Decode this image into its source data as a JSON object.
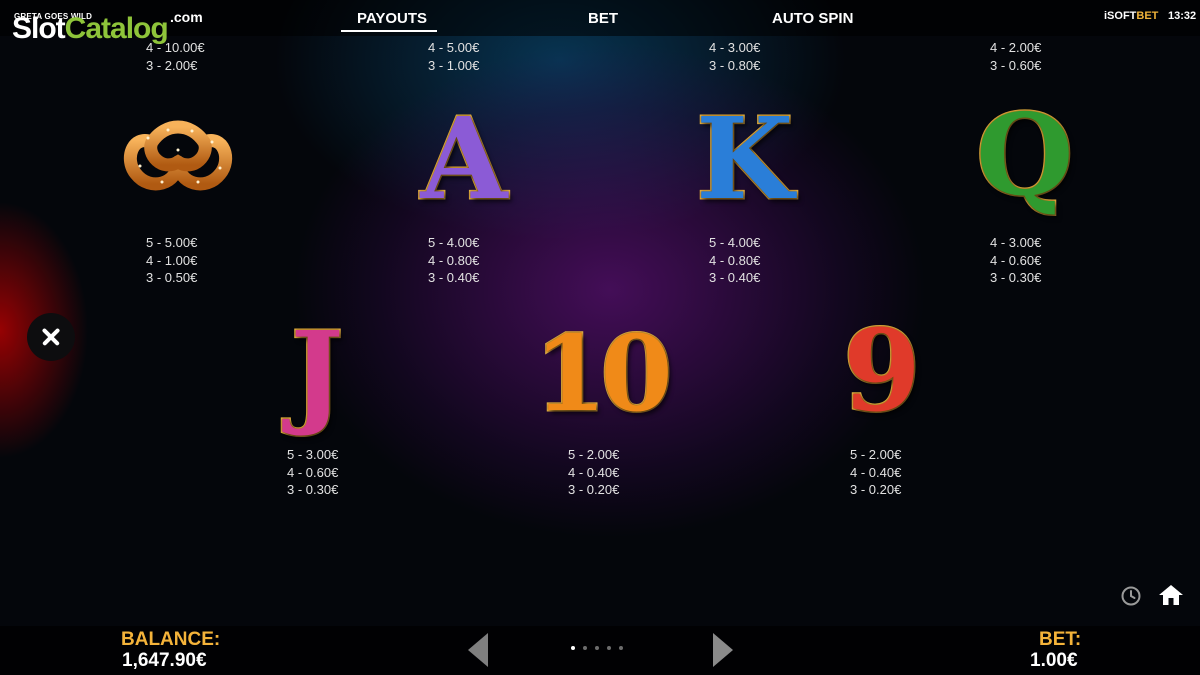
{
  "header": {
    "game_title": "GRETA GOES WILD",
    "watermark": {
      "part1": "Slot",
      "part2": "Catalog",
      "suffix": ".com"
    },
    "tabs": [
      {
        "label": "PAYOUTS",
        "active": true
      },
      {
        "label": "BET",
        "active": false
      },
      {
        "label": "AUTO SPIN",
        "active": false
      }
    ],
    "brand": {
      "prefix": "iSOFT",
      "suffix": "BET"
    },
    "time": "13:32"
  },
  "paytable": {
    "top_row_partial": [
      {
        "lines": [
          "4 - 10.00€",
          "3 - 2.00€"
        ]
      },
      {
        "lines": [
          "4 - 5.00€",
          "3 - 1.00€"
        ]
      },
      {
        "lines": [
          "4 - 3.00€",
          "3 - 0.80€"
        ]
      },
      {
        "lines": [
          "4 - 2.00€",
          "3 - 0.60€"
        ]
      }
    ],
    "symbols": [
      {
        "name": "Pretzel",
        "lines": [
          "5 - 5.00€",
          "4 - 1.00€",
          "3 - 0.50€"
        ]
      },
      {
        "name": "A",
        "glyph": "A",
        "lines": [
          "5 - 4.00€",
          "4 - 0.80€",
          "3 - 0.40€"
        ]
      },
      {
        "name": "K",
        "glyph": "K",
        "lines": [
          "5 - 4.00€",
          "4 - 0.80€",
          "3 - 0.40€"
        ]
      },
      {
        "name": "Q",
        "glyph": "Q",
        "lines": [
          "4 - 3.00€",
          "4 - 0.60€",
          "3 - 0.30€"
        ]
      },
      {
        "name": "J",
        "glyph": "J",
        "lines": [
          "5 - 3.00€",
          "4 - 0.60€",
          "3 - 0.30€"
        ]
      },
      {
        "name": "10",
        "glyph": "10",
        "lines": [
          "5 - 2.00€",
          "4 - 0.40€",
          "3 - 0.20€"
        ]
      },
      {
        "name": "9",
        "glyph": "9",
        "lines": [
          "5 - 2.00€",
          "4 - 0.40€",
          "3 - 0.20€"
        ]
      }
    ]
  },
  "footer": {
    "balance_label": "BALANCE:",
    "balance_value": "1,647.90€",
    "bet_label": "BET:",
    "bet_value": "1.00€",
    "page_count": 5,
    "current_page": 1
  },
  "colors": {
    "gold_label": "#f4b33a",
    "symbol_A": "#8b5bd6",
    "symbol_K": "#2a7ed8",
    "symbol_Q": "#2f9a2f",
    "symbol_J": "#d33a8c",
    "symbol_10": "#f08a18",
    "symbol_9": "#e03a2a"
  },
  "icons": [
    "close-icon",
    "history-icon",
    "home-icon",
    "arrow-left-icon",
    "arrow-right-icon"
  ]
}
